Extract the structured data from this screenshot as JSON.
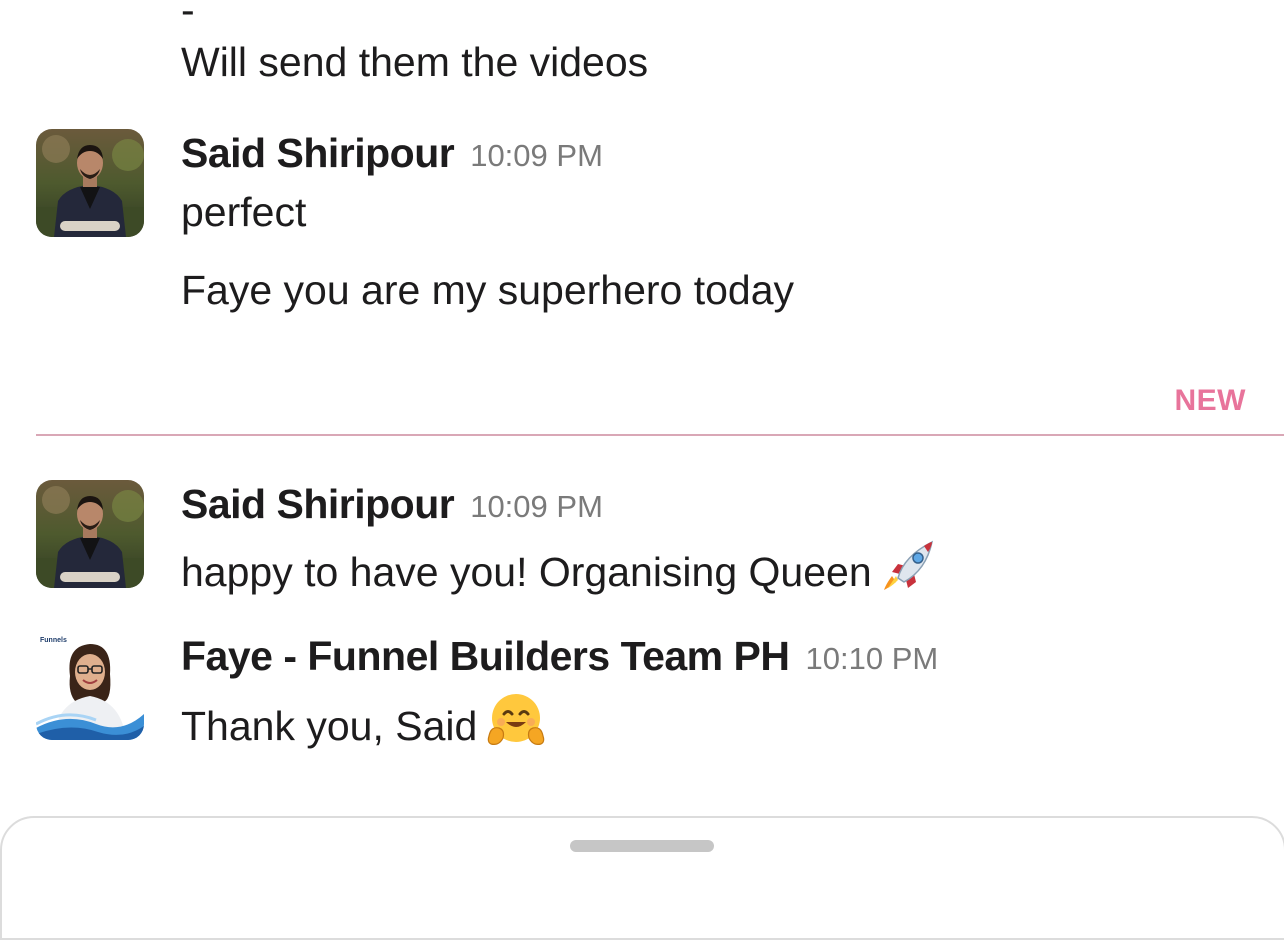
{
  "messages": {
    "m0": {
      "dash": "-",
      "text": "Will send them the videos"
    },
    "m1": {
      "author": "Said Shiripour",
      "time": "10:09 PM",
      "lines": [
        "perfect",
        "Faye you are my superhero today"
      ]
    },
    "divider": {
      "label": "NEW"
    },
    "m2": {
      "author": "Said Shiripour",
      "time": "10:09 PM",
      "text": "happy to have you! Organising Queen",
      "emoji": "rocket-emoji"
    },
    "m3": {
      "author": "Faye - Funnel Builders Team PH",
      "time": "10:10 PM",
      "text": "Thank you, Said",
      "emoji": "hugging-face-emoji",
      "avatar_badge": "Funnels"
    }
  },
  "colors": {
    "new_accent": "#e8749b",
    "divider_line": "#d9a7b6",
    "timestamp": "#7a7a7a",
    "text": "#1d1c1d"
  }
}
